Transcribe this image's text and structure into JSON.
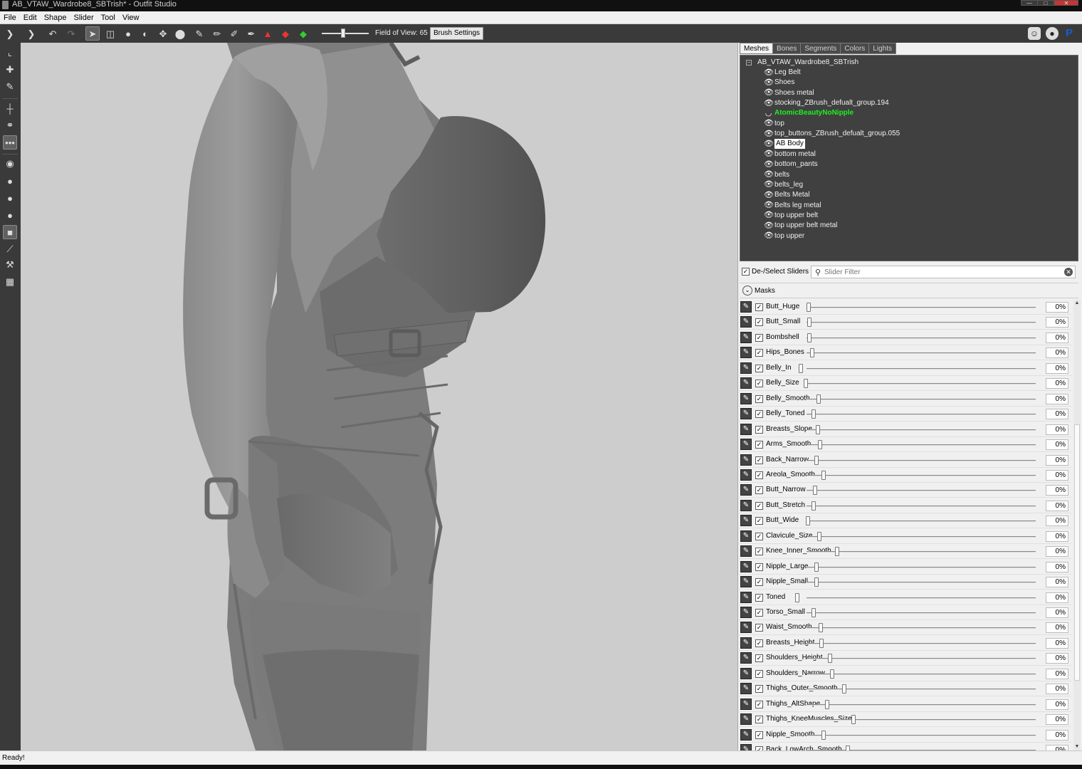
{
  "window": {
    "title": "AB_VTAW_Wardrobe8_SBTrish* - Outfit Studio"
  },
  "menu": [
    "File",
    "Edit",
    "Shape",
    "Slider",
    "Tool",
    "View"
  ],
  "toolbar": {
    "fov_label": "Field of View: 65",
    "fov_value": 65,
    "brush_settings": "Brush Settings",
    "tool_icons": [
      "logo-icon",
      "load-icon",
      "undo-icon",
      "redo-icon",
      "select-brush-icon",
      "mask-brush-icon",
      "inflate-brush-icon",
      "deflate-brush-icon",
      "move-brush-icon",
      "smooth-brush-icon",
      "undiff-brush-icon",
      "color-brush-icon",
      "alpha-brush-icon",
      "weight-brush-icon",
      "transform-icon",
      "collapse-icon",
      "expand-icon"
    ],
    "right_icons": [
      "discord-icon",
      "github-icon",
      "paypal-icon"
    ]
  },
  "left_tools": [
    "transform-icon",
    "pivot-icon",
    "vertex-select-icon",
    "split-icon",
    "move-pivot-icon",
    "brush-options-icon",
    "sphere-1-icon",
    "sphere-2-icon",
    "sphere-3-icon",
    "sphere-4-icon",
    "cube-icon",
    "edge-icon",
    "weld-icon",
    "grid-icon"
  ],
  "tabs": [
    {
      "label": "Meshes",
      "active": true
    },
    {
      "label": "Bones",
      "active": false
    },
    {
      "label": "Segments",
      "active": false
    },
    {
      "label": "Colors",
      "active": false
    },
    {
      "label": "Lights",
      "active": false
    }
  ],
  "mesh_tree": {
    "root": "AB_VTAW_Wardrobe8_SBTrish",
    "items": [
      {
        "label": "Leg Belt",
        "state": "normal"
      },
      {
        "label": "Shoes",
        "state": "normal"
      },
      {
        "label": "Shoes metal",
        "state": "normal"
      },
      {
        "label": "stocking_ZBrush_defualt_group.194",
        "state": "normal"
      },
      {
        "label": "AtomicBeautyNoNipple",
        "state": "highlight"
      },
      {
        "label": "top",
        "state": "normal"
      },
      {
        "label": "top_buttons_ZBrush_defualt_group.055",
        "state": "normal"
      },
      {
        "label": "AB Body",
        "state": "selected"
      },
      {
        "label": "bottom metal",
        "state": "normal"
      },
      {
        "label": "bottom_pants",
        "state": "normal"
      },
      {
        "label": "belts",
        "state": "normal"
      },
      {
        "label": "belts_leg",
        "state": "normal"
      },
      {
        "label": "Belts Metal",
        "state": "normal"
      },
      {
        "label": "Belts leg metal",
        "state": "normal"
      },
      {
        "label": "top upper belt",
        "state": "normal"
      },
      {
        "label": "top upper belt metal",
        "state": "normal"
      },
      {
        "label": "top upper",
        "state": "normal"
      }
    ]
  },
  "slider_panel": {
    "deselect_label": "De-/Select Sliders",
    "filter_placeholder": "Slider Filter",
    "masks_label": "Masks"
  },
  "sliders": [
    {
      "name": "Butt_Huge",
      "value": "0%",
      "pos": 0.0
    },
    {
      "name": "Butt_Small",
      "value": "0%",
      "pos": 0.0
    },
    {
      "name": "Bombshell",
      "value": "0%",
      "pos": 0.0
    },
    {
      "name": "Hips_Bones",
      "value": "0%",
      "pos": 0.0
    },
    {
      "name": "Belly_In",
      "value": "0%",
      "pos": 0.0
    },
    {
      "name": "Belly_Size",
      "value": "0%",
      "pos": 0.0
    },
    {
      "name": "Belly_Smooth",
      "value": "0%",
      "pos": 0.0
    },
    {
      "name": "Belly_Toned",
      "value": "0%",
      "pos": 0.0
    },
    {
      "name": "Breasts_Slope",
      "value": "0%",
      "pos": 0.0
    },
    {
      "name": "Arms_Smooth",
      "value": "0%",
      "pos": 0.0
    },
    {
      "name": "Back_Narrow",
      "value": "0%",
      "pos": 0.0
    },
    {
      "name": "Areola_Smooth",
      "value": "0%",
      "pos": 0.0
    },
    {
      "name": "Butt_Narrow",
      "value": "0%",
      "pos": 0.0
    },
    {
      "name": "Butt_Stretch",
      "value": "0%",
      "pos": 0.0
    },
    {
      "name": "Butt_Wide",
      "value": "0%",
      "pos": 0.0
    },
    {
      "name": "Clavicule_Size",
      "value": "0%",
      "pos": 0.0
    },
    {
      "name": "Knee_Inner_Smooth",
      "value": "0%",
      "pos": 0.0
    },
    {
      "name": "Nipple_Large",
      "value": "0%",
      "pos": 0.0
    },
    {
      "name": "Nipple_Small",
      "value": "0%",
      "pos": 0.0
    },
    {
      "name": "Toned",
      "value": "0%",
      "pos": 0.0
    },
    {
      "name": "Torso_Small",
      "value": "0%",
      "pos": 0.0
    },
    {
      "name": "Waist_Smooth",
      "value": "0%",
      "pos": 0.0
    },
    {
      "name": "Breasts_Height",
      "value": "0%",
      "pos": 0.0
    },
    {
      "name": "Shoulders_Height",
      "value": "0%",
      "pos": 0.0
    },
    {
      "name": "Shoulders_Narrow",
      "value": "0%",
      "pos": 0.0
    },
    {
      "name": "Thighs_Outer_Smooth",
      "value": "0%",
      "pos": 0.0
    },
    {
      "name": "Thighs_AltShape",
      "value": "0%",
      "pos": 0.0
    },
    {
      "name": "Thighs_KneeMuscles_Size",
      "value": "0%",
      "pos": 0.0
    },
    {
      "name": "Nipple_Smooth",
      "value": "0%",
      "pos": 0.0
    },
    {
      "name": "Back_LowArch_Smooth",
      "value": "0%",
      "pos": 0.0
    }
  ],
  "status": "Ready!",
  "colors": {
    "highlight_mesh": "#1ef01e",
    "panel_dark": "#404040",
    "toolbar": "#3a3a3a",
    "viewport_bg": "#cdcdcd"
  }
}
